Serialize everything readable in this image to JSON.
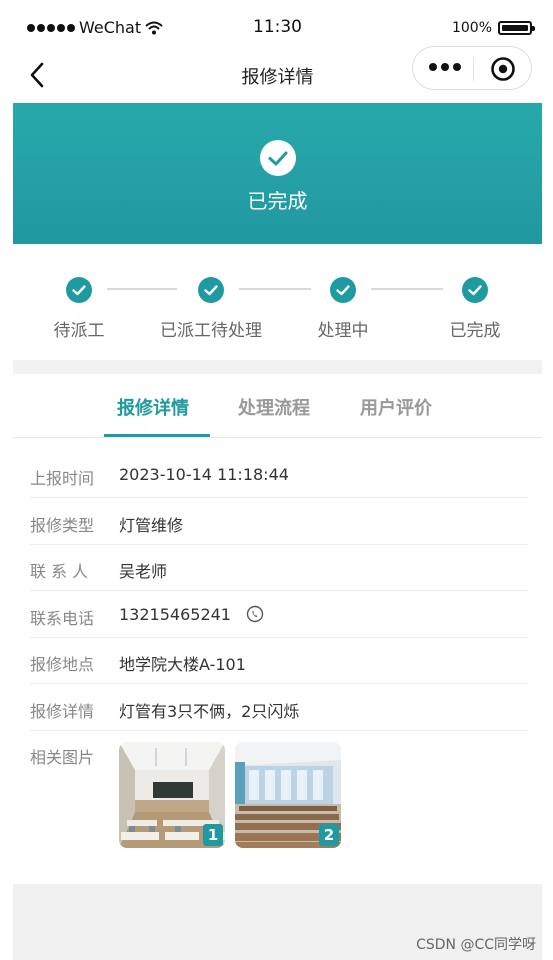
{
  "status_bar": {
    "carrier": "WeChat",
    "time": "11:30",
    "battery": "100%"
  },
  "nav": {
    "title": "报修详情"
  },
  "hero": {
    "status": "已完成"
  },
  "steps": [
    {
      "label": "待派工"
    },
    {
      "label": "已派工待处理"
    },
    {
      "label": "处理中"
    },
    {
      "label": "已完成"
    }
  ],
  "tabs": [
    {
      "label": "报修详情",
      "active": true
    },
    {
      "label": "处理流程",
      "active": false
    },
    {
      "label": "用户评价",
      "active": false
    }
  ],
  "details": [
    {
      "key": "上报时间",
      "value": "2023-10-14 11:18:44"
    },
    {
      "key": "报修类型",
      "value": "灯管维修"
    },
    {
      "key": "联 系 人",
      "value": "吴老师"
    },
    {
      "key": "联系电话",
      "value": "13215465241"
    },
    {
      "key": "报修地点",
      "value": "地学院大楼A-101"
    },
    {
      "key": "报修详情",
      "value": "灯管有3只不俩，2只闪烁"
    },
    {
      "key": "相关图片",
      "value": ""
    }
  ],
  "images": [
    {
      "badge": "1"
    },
    {
      "badge": "2"
    }
  ],
  "footer": {
    "mark": "CSDN @CC同学呀"
  },
  "colors": {
    "accent": "#1f9aa0",
    "hero": "#27a9ab",
    "background": "#f2f2f2"
  }
}
